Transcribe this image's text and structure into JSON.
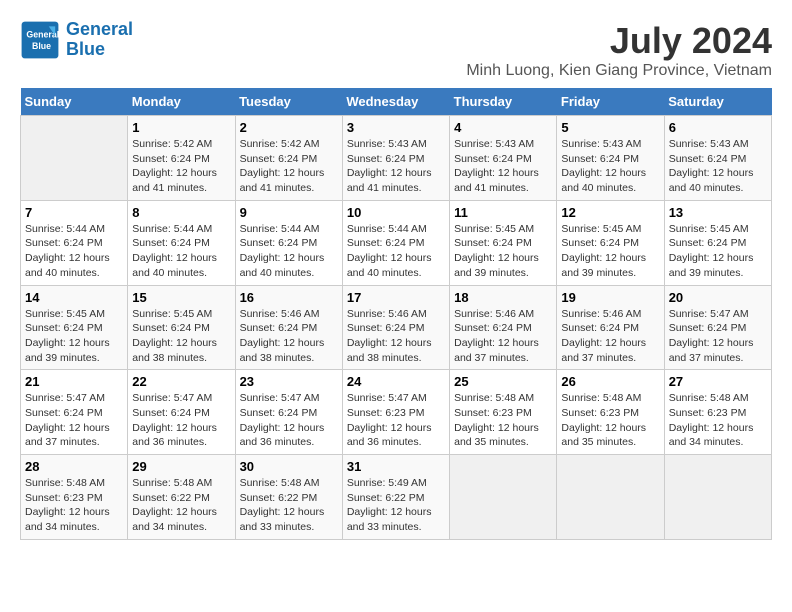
{
  "header": {
    "logo_line1": "General",
    "logo_line2": "Blue",
    "title": "July 2024",
    "subtitle": "Minh Luong, Kien Giang Province, Vietnam"
  },
  "weekdays": [
    "Sunday",
    "Monday",
    "Tuesday",
    "Wednesday",
    "Thursday",
    "Friday",
    "Saturday"
  ],
  "weeks": [
    [
      {
        "day": "",
        "info": ""
      },
      {
        "day": "1",
        "info": "Sunrise: 5:42 AM\nSunset: 6:24 PM\nDaylight: 12 hours\nand 41 minutes."
      },
      {
        "day": "2",
        "info": "Sunrise: 5:42 AM\nSunset: 6:24 PM\nDaylight: 12 hours\nand 41 minutes."
      },
      {
        "day": "3",
        "info": "Sunrise: 5:43 AM\nSunset: 6:24 PM\nDaylight: 12 hours\nand 41 minutes."
      },
      {
        "day": "4",
        "info": "Sunrise: 5:43 AM\nSunset: 6:24 PM\nDaylight: 12 hours\nand 41 minutes."
      },
      {
        "day": "5",
        "info": "Sunrise: 5:43 AM\nSunset: 6:24 PM\nDaylight: 12 hours\nand 40 minutes."
      },
      {
        "day": "6",
        "info": "Sunrise: 5:43 AM\nSunset: 6:24 PM\nDaylight: 12 hours\nand 40 minutes."
      }
    ],
    [
      {
        "day": "7",
        "info": "Sunrise: 5:44 AM\nSunset: 6:24 PM\nDaylight: 12 hours\nand 40 minutes."
      },
      {
        "day": "8",
        "info": "Sunrise: 5:44 AM\nSunset: 6:24 PM\nDaylight: 12 hours\nand 40 minutes."
      },
      {
        "day": "9",
        "info": "Sunrise: 5:44 AM\nSunset: 6:24 PM\nDaylight: 12 hours\nand 40 minutes."
      },
      {
        "day": "10",
        "info": "Sunrise: 5:44 AM\nSunset: 6:24 PM\nDaylight: 12 hours\nand 40 minutes."
      },
      {
        "day": "11",
        "info": "Sunrise: 5:45 AM\nSunset: 6:24 PM\nDaylight: 12 hours\nand 39 minutes."
      },
      {
        "day": "12",
        "info": "Sunrise: 5:45 AM\nSunset: 6:24 PM\nDaylight: 12 hours\nand 39 minutes."
      },
      {
        "day": "13",
        "info": "Sunrise: 5:45 AM\nSunset: 6:24 PM\nDaylight: 12 hours\nand 39 minutes."
      }
    ],
    [
      {
        "day": "14",
        "info": "Sunrise: 5:45 AM\nSunset: 6:24 PM\nDaylight: 12 hours\nand 39 minutes."
      },
      {
        "day": "15",
        "info": "Sunrise: 5:45 AM\nSunset: 6:24 PM\nDaylight: 12 hours\nand 38 minutes."
      },
      {
        "day": "16",
        "info": "Sunrise: 5:46 AM\nSunset: 6:24 PM\nDaylight: 12 hours\nand 38 minutes."
      },
      {
        "day": "17",
        "info": "Sunrise: 5:46 AM\nSunset: 6:24 PM\nDaylight: 12 hours\nand 38 minutes."
      },
      {
        "day": "18",
        "info": "Sunrise: 5:46 AM\nSunset: 6:24 PM\nDaylight: 12 hours\nand 37 minutes."
      },
      {
        "day": "19",
        "info": "Sunrise: 5:46 AM\nSunset: 6:24 PM\nDaylight: 12 hours\nand 37 minutes."
      },
      {
        "day": "20",
        "info": "Sunrise: 5:47 AM\nSunset: 6:24 PM\nDaylight: 12 hours\nand 37 minutes."
      }
    ],
    [
      {
        "day": "21",
        "info": "Sunrise: 5:47 AM\nSunset: 6:24 PM\nDaylight: 12 hours\nand 37 minutes."
      },
      {
        "day": "22",
        "info": "Sunrise: 5:47 AM\nSunset: 6:24 PM\nDaylight: 12 hours\nand 36 minutes."
      },
      {
        "day": "23",
        "info": "Sunrise: 5:47 AM\nSunset: 6:24 PM\nDaylight: 12 hours\nand 36 minutes."
      },
      {
        "day": "24",
        "info": "Sunrise: 5:47 AM\nSunset: 6:23 PM\nDaylight: 12 hours\nand 36 minutes."
      },
      {
        "day": "25",
        "info": "Sunrise: 5:48 AM\nSunset: 6:23 PM\nDaylight: 12 hours\nand 35 minutes."
      },
      {
        "day": "26",
        "info": "Sunrise: 5:48 AM\nSunset: 6:23 PM\nDaylight: 12 hours\nand 35 minutes."
      },
      {
        "day": "27",
        "info": "Sunrise: 5:48 AM\nSunset: 6:23 PM\nDaylight: 12 hours\nand 34 minutes."
      }
    ],
    [
      {
        "day": "28",
        "info": "Sunrise: 5:48 AM\nSunset: 6:23 PM\nDaylight: 12 hours\nand 34 minutes."
      },
      {
        "day": "29",
        "info": "Sunrise: 5:48 AM\nSunset: 6:22 PM\nDaylight: 12 hours\nand 34 minutes."
      },
      {
        "day": "30",
        "info": "Sunrise: 5:48 AM\nSunset: 6:22 PM\nDaylight: 12 hours\nand 33 minutes."
      },
      {
        "day": "31",
        "info": "Sunrise: 5:49 AM\nSunset: 6:22 PM\nDaylight: 12 hours\nand 33 minutes."
      },
      {
        "day": "",
        "info": ""
      },
      {
        "day": "",
        "info": ""
      },
      {
        "day": "",
        "info": ""
      }
    ]
  ]
}
